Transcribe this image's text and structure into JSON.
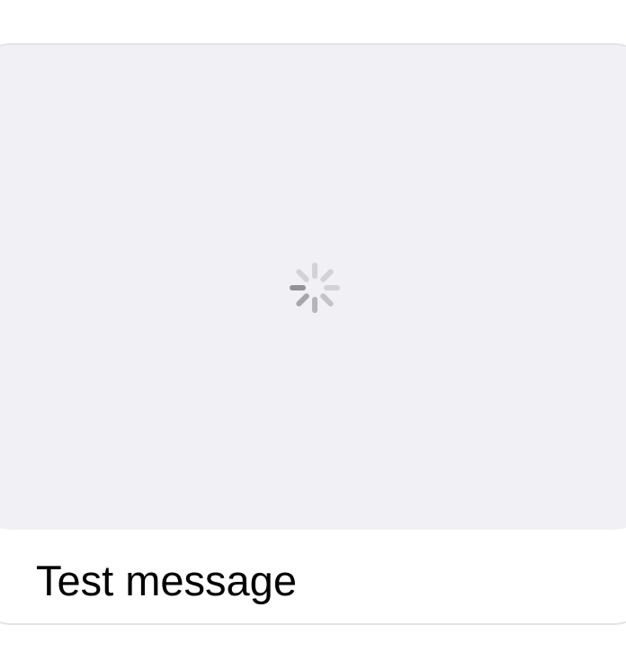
{
  "message": {
    "text": "Test message",
    "media_state": "loading",
    "spinner_icon": "activity-indicator-icon"
  },
  "colors": {
    "card_border": "#e3e3e8",
    "media_background": "#f1f0f5",
    "spinner": "#8e8e93",
    "text": "#000000"
  }
}
